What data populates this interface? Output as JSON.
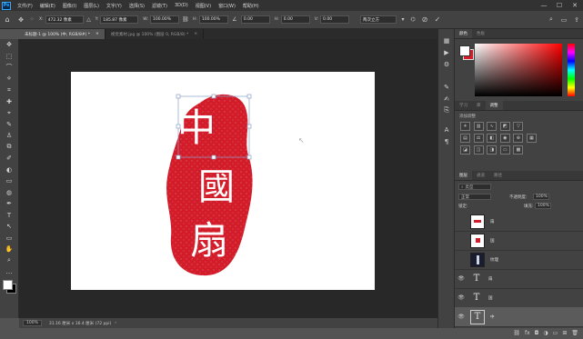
{
  "app": {
    "logo": "Ps"
  },
  "menu": [
    "文件(F)",
    "编辑(E)",
    "图像(I)",
    "图层(L)",
    "文字(Y)",
    "选择(S)",
    "滤镜(T)",
    "3D(D)",
    "视图(V)",
    "窗口(W)",
    "帮助(H)"
  ],
  "window_controls": [
    "—",
    "☐",
    "✕"
  ],
  "options": {
    "x_label": "X:",
    "x_value": "472.32 像素",
    "y_label": "Y:",
    "y_value": "185.87 像素",
    "w_label": "W:",
    "w_value": "100.00%",
    "h_label": "H:",
    "h_value": "100.00%",
    "angle_value": "0.00",
    "hskew_label": "H:",
    "hskew_value": "0.00",
    "vskew_label": "V:",
    "vskew_value": "0.00",
    "interp_value": "两次立方"
  },
  "tabs": [
    {
      "label": "未标题-1 @ 100% (中, RGB/8#) *",
      "close": "×"
    },
    {
      "label": "视觉素材.jpg @ 100% (图层 0, RGB/8) *",
      "close": "×"
    }
  ],
  "status": {
    "zoom": "100%",
    "doc_size": "31.16 厘米 x 16.4 厘米 (72 ppi)"
  },
  "tools": [
    "✥",
    "⬚",
    "⌒",
    "⟡",
    "⌗",
    "✚",
    "⌖",
    "✎",
    "♙",
    "⧉",
    "✐",
    "◐",
    "▭",
    "◍",
    "✒",
    "T",
    "↖",
    "▭",
    "✋",
    "⌕",
    "…"
  ],
  "color_panel": {
    "tabs": [
      "颜色",
      "色板"
    ],
    "fg_color": "#d21c2a",
    "bg_color": "#ffffff"
  },
  "adjust_panel": {
    "tabs": [
      "学习",
      "库",
      "调整"
    ],
    "title": "添加调整"
  },
  "layers_panel": {
    "tabs": [
      "图层",
      "通道",
      "路径"
    ],
    "search_placeholder": "类型",
    "blend_mode": "正常",
    "opacity_label": "不透明度:",
    "opacity_value": "100%",
    "lock_label": "锁定:",
    "fill_label": "填充:",
    "fill_value": "100%",
    "layers": [
      {
        "name": "扇",
        "visible": false,
        "kind": "image"
      },
      {
        "name": "国",
        "visible": false,
        "kind": "image"
      },
      {
        "name": "纹理",
        "visible": false,
        "kind": "dark"
      },
      {
        "name": "扇",
        "visible": true,
        "kind": "text"
      },
      {
        "name": "国",
        "visible": true,
        "kind": "text"
      },
      {
        "name": "中",
        "visible": true,
        "kind": "text",
        "selected": true
      }
    ]
  },
  "seal": {
    "chars": [
      "中",
      "國",
      "扇"
    ],
    "color": "#d21c2a"
  }
}
